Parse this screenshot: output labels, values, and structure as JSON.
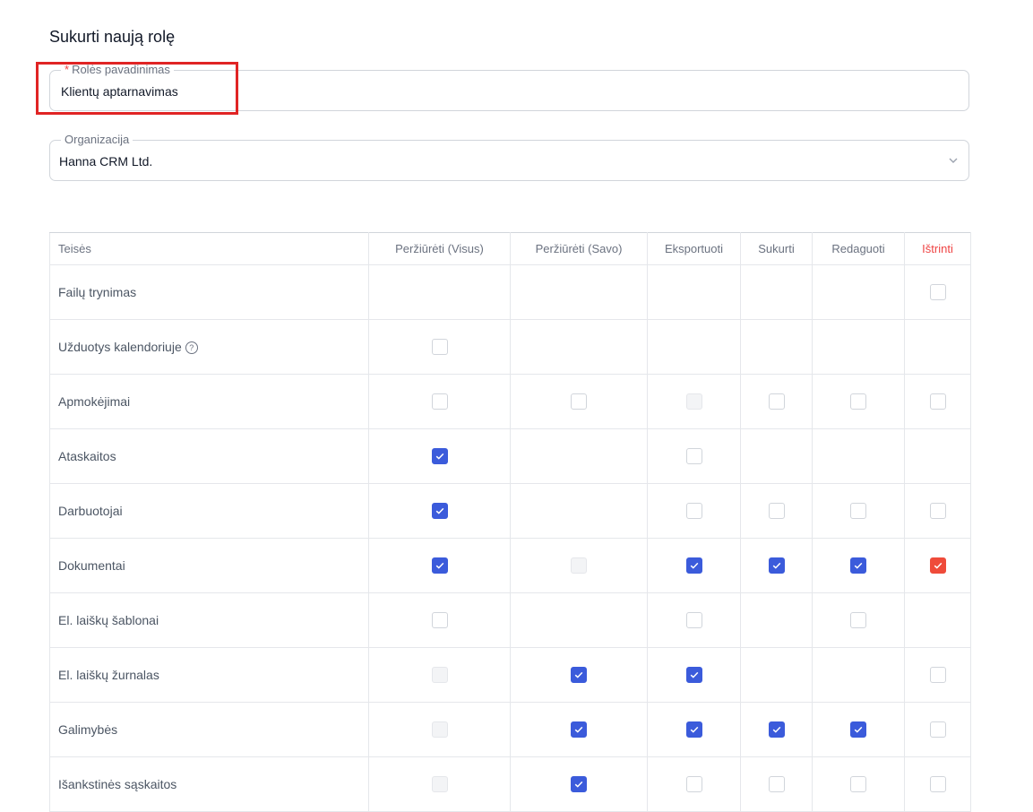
{
  "page": {
    "title": "Sukurti naują rolę"
  },
  "role_name_field": {
    "required_mark": "*",
    "label": "Rolės pavadinimas",
    "value": "Klientų aptarnavimas"
  },
  "organization_field": {
    "label": "Organizacija",
    "value": "Hanna CRM Ltd."
  },
  "permissions_table": {
    "columns": [
      "Teisės",
      "Peržiūrėti (Visus)",
      "Peržiūrėti (Savo)",
      "Eksportuoti",
      "Sukurti",
      "Redaguoti",
      "Ištrinti"
    ],
    "rows": [
      {
        "name": "Failų trynimas",
        "help": false,
        "cells": [
          null,
          null,
          null,
          null,
          null,
          "unchecked"
        ]
      },
      {
        "name": "Užduotys kalendoriuje",
        "help": true,
        "cells": [
          "unchecked",
          null,
          null,
          null,
          null,
          null
        ]
      },
      {
        "name": "Apmokėjimai",
        "help": false,
        "cells": [
          "unchecked",
          "unchecked",
          "disabled",
          "unchecked",
          "unchecked",
          "unchecked"
        ]
      },
      {
        "name": "Ataskaitos",
        "help": false,
        "cells": [
          "checked",
          null,
          "unchecked",
          null,
          null,
          null
        ]
      },
      {
        "name": "Darbuotojai",
        "help": false,
        "cells": [
          "checked",
          null,
          "unchecked",
          "unchecked",
          "unchecked",
          "unchecked"
        ]
      },
      {
        "name": "Dokumentai",
        "help": false,
        "cells": [
          "checked",
          "disabled",
          "checked",
          "checked",
          "checked",
          "checked"
        ]
      },
      {
        "name": "El. laiškų šablonai",
        "help": false,
        "cells": [
          "unchecked",
          null,
          "unchecked",
          null,
          "unchecked",
          null
        ]
      },
      {
        "name": "El. laiškų žurnalas",
        "help": false,
        "cells": [
          "disabled",
          "checked",
          "checked",
          null,
          null,
          "unchecked"
        ]
      },
      {
        "name": "Galimybės",
        "help": false,
        "cells": [
          "disabled",
          "checked",
          "checked",
          "checked",
          "checked",
          "unchecked"
        ]
      },
      {
        "name": "Išankstinės sąskaitos",
        "help": false,
        "cells": [
          "disabled",
          "checked",
          "unchecked",
          "unchecked",
          "unchecked",
          "unchecked"
        ]
      }
    ]
  },
  "colors": {
    "accent": "#3b5bdb",
    "danger": "#ef4b3a",
    "highlight_box": "#e02424"
  },
  "icons": {
    "help": "question-circle-icon",
    "dropdown": "chevron-down-icon",
    "check": "check-icon"
  }
}
